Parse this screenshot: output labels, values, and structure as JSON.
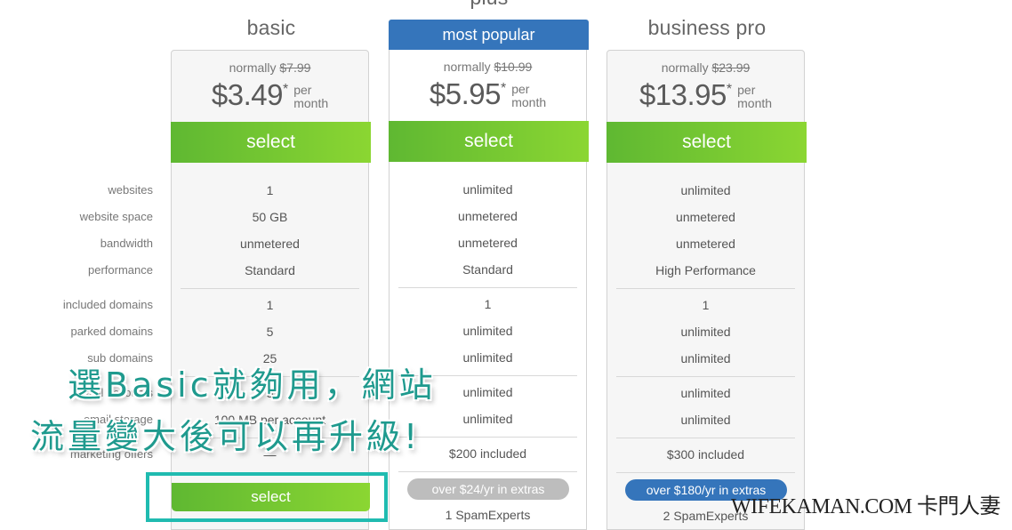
{
  "feature_labels": {
    "websites": "websites",
    "website_space": "website space",
    "bandwidth": "bandwidth",
    "performance": "performance",
    "included_domains": "included domains",
    "parked_domains": "parked domains",
    "sub_domains": "sub domains",
    "email_accounts": "email accounts",
    "email_storage": "email storage",
    "marketing_offers": "marketing offers"
  },
  "plans": [
    {
      "title": "basic",
      "normally_label": "normally",
      "old_price": "$7.99",
      "price": "$3.49",
      "asterisk": "*",
      "per": "per",
      "month": "month",
      "select_label": "select",
      "websites": "1",
      "website_space": "50 GB",
      "bandwidth": "unmetered",
      "performance": "Standard",
      "included_domains": "1",
      "parked_domains": "5",
      "sub_domains": "25",
      "email_accounts": "5",
      "email_storage": "100 MB per account",
      "marketing_offers": "—",
      "bottom_select_label": "select"
    },
    {
      "title": "plus",
      "badge": "most popular",
      "normally_label": "normally",
      "old_price": "$10.99",
      "price": "$5.95",
      "asterisk": "*",
      "per": "per",
      "month": "month",
      "select_label": "select",
      "websites": "unlimited",
      "website_space": "unmetered",
      "bandwidth": "unmetered",
      "performance": "Standard",
      "included_domains": "1",
      "parked_domains": "unlimited",
      "sub_domains": "unlimited",
      "email_accounts": "unlimited",
      "email_storage": "unlimited",
      "marketing_offers": "$200 included",
      "extras_pill": "over $24/yr in extras",
      "spam": "1 SpamExperts"
    },
    {
      "title": "business pro",
      "normally_label": "normally",
      "old_price": "$23.99",
      "price": "$13.95",
      "asterisk": "*",
      "per": "per",
      "month": "month",
      "select_label": "select",
      "websites": "unlimited",
      "website_space": "unmetered",
      "bandwidth": "unmetered",
      "performance": "High Performance",
      "included_domains": "1",
      "parked_domains": "unlimited",
      "sub_domains": "unlimited",
      "email_accounts": "unlimited",
      "email_storage": "unlimited",
      "marketing_offers": "$300 included",
      "extras_pill": "over $180/yr in extras",
      "spam": "2 SpamExperts"
    }
  ],
  "overlay": {
    "line1": "選Basic就夠用，網站",
    "line2": "流量變大後可以再升級!"
  },
  "watermark": "WIFEKAMAN.COM 卡門人妻",
  "colors": {
    "select_green_start": "#5fb832",
    "select_green_end": "#8bd632",
    "popular_blue": "#3575bb",
    "pill_gray": "#bdbdbd",
    "highlight_teal": "#20bbb0",
    "overlay_teal": "#1f9a8e"
  }
}
